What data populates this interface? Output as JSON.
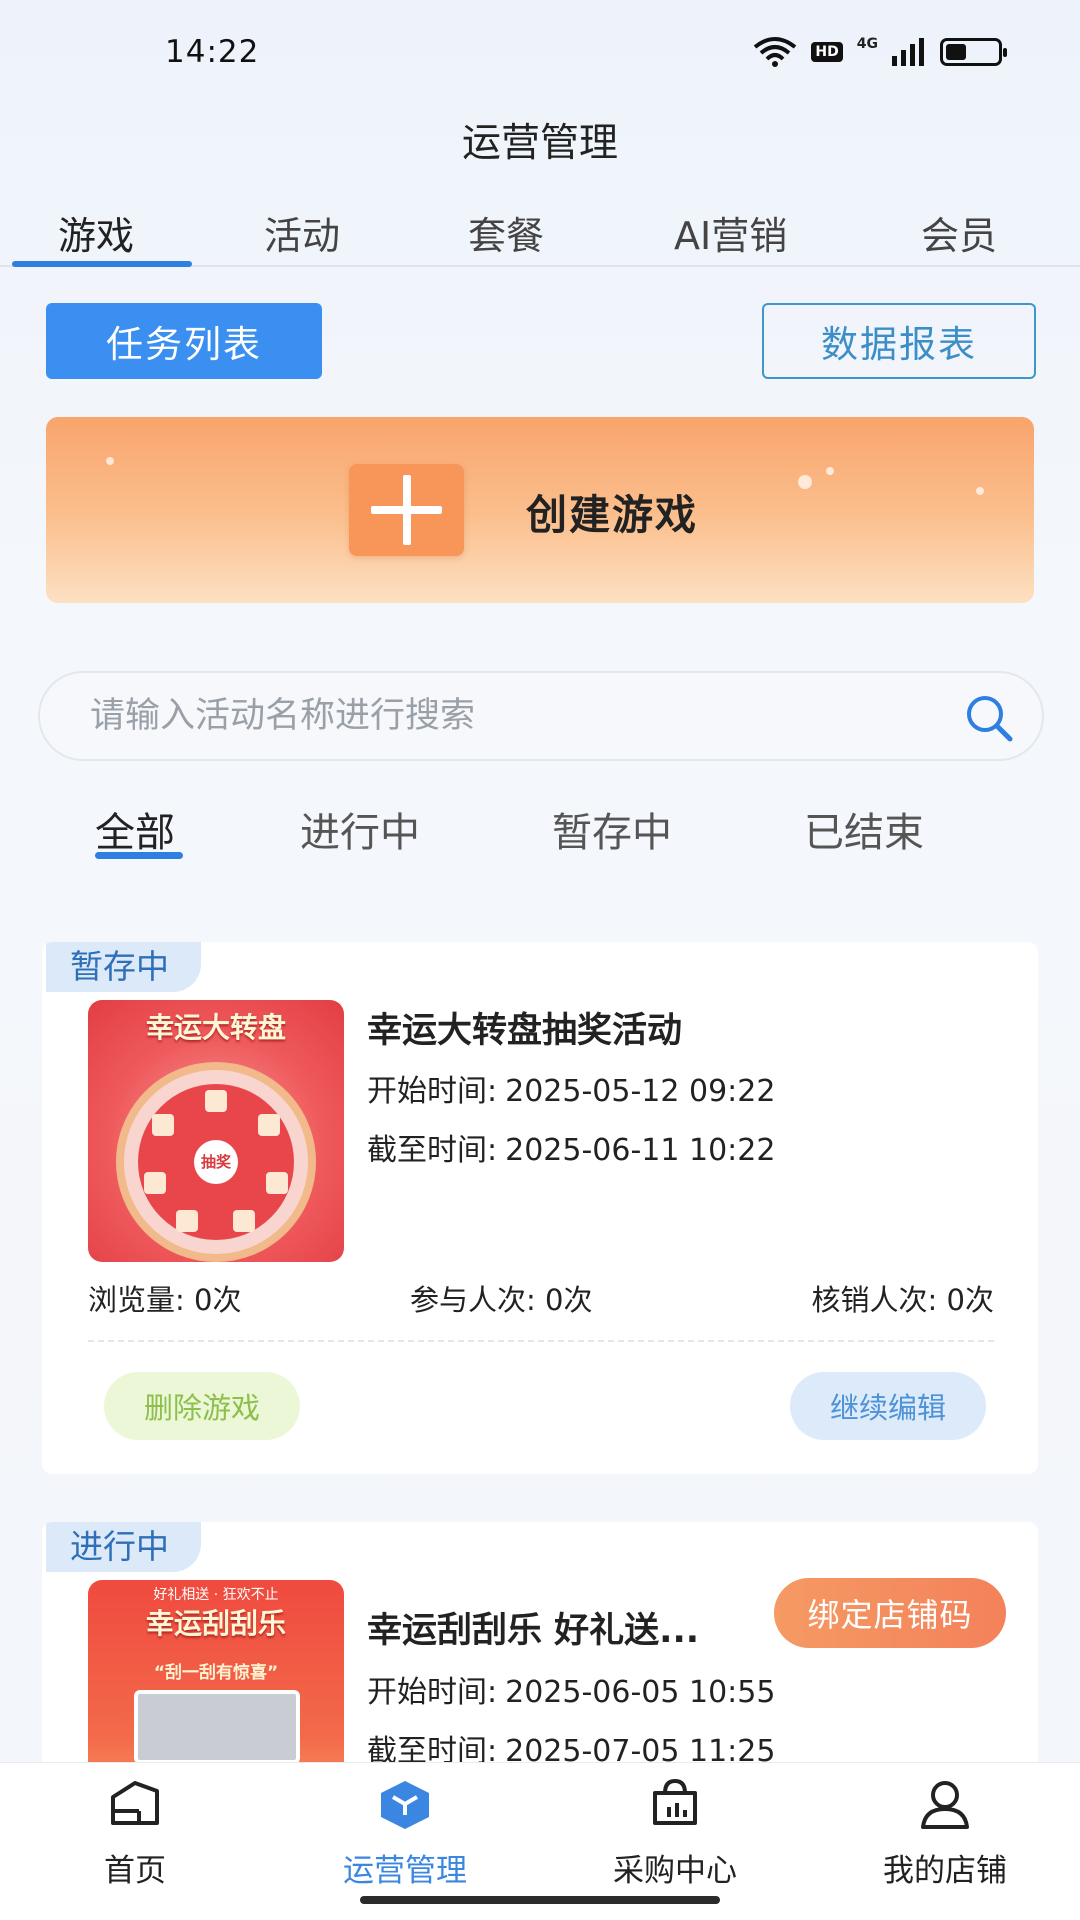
{
  "status_bar": {
    "time": "14:22",
    "hd_label": "HD",
    "network_label": "4G",
    "battery_level": 0.4
  },
  "header": {
    "title": "运营管理"
  },
  "top_tabs": [
    {
      "label": "游戏",
      "active": true
    },
    {
      "label": "活动",
      "active": false
    },
    {
      "label": "套餐",
      "active": false
    },
    {
      "label": "AI营销",
      "active": false
    },
    {
      "label": "会员",
      "active": false
    }
  ],
  "actions": {
    "task_list": "任务列表",
    "data_report": "数据报表"
  },
  "create_banner": {
    "label": "创建游戏"
  },
  "search": {
    "placeholder": "请输入活动名称进行搜索",
    "value": ""
  },
  "filter_tabs": [
    {
      "label": "全部",
      "active": true
    },
    {
      "label": "进行中",
      "active": false
    },
    {
      "label": "暂存中",
      "active": false
    },
    {
      "label": "已结束",
      "active": false
    }
  ],
  "cards": [
    {
      "status": "暂存中",
      "thumbnail_title": "幸运大转盘",
      "thumbnail_center": "抽奖",
      "title": "幸运大转盘抽奖活动",
      "start_label": "开始时间:",
      "start_time": "2025-05-12 09:22",
      "end_label": "截至时间:",
      "end_time": "2025-06-11 10:22",
      "stats": [
        {
          "label": "浏览量:",
          "value": "0次"
        },
        {
          "label": "参与人次:",
          "value": "0次"
        },
        {
          "label": "核销人次:",
          "value": "0次"
        }
      ],
      "delete_label": "删除游戏",
      "edit_label": "继续编辑"
    },
    {
      "status": "进行中",
      "thumbnail_subtitle": "好礼相送 · 狂欢不止",
      "thumbnail_title": "幸运刮刮乐",
      "thumbnail_caption": "“刮一刮有惊喜”",
      "title": "幸运刮刮乐 好礼送...",
      "bind_label": "绑定店铺码",
      "start_label": "开始时间:",
      "start_time": "2025-06-05 10:55",
      "end_label": "截至时间:",
      "end_time": "2025-07-05 11:25"
    }
  ],
  "bottom_nav": [
    {
      "label": "首页",
      "icon": "home-icon",
      "active": false
    },
    {
      "label": "运营管理",
      "icon": "cube-icon",
      "active": true
    },
    {
      "label": "采购中心",
      "icon": "shop-chart-icon",
      "active": false
    },
    {
      "label": "我的店铺",
      "icon": "user-icon",
      "active": false
    }
  ],
  "colors": {
    "accent": "#3a8ff0",
    "orange": "#f59a63",
    "tab_indicator": "#2f7fe0"
  }
}
